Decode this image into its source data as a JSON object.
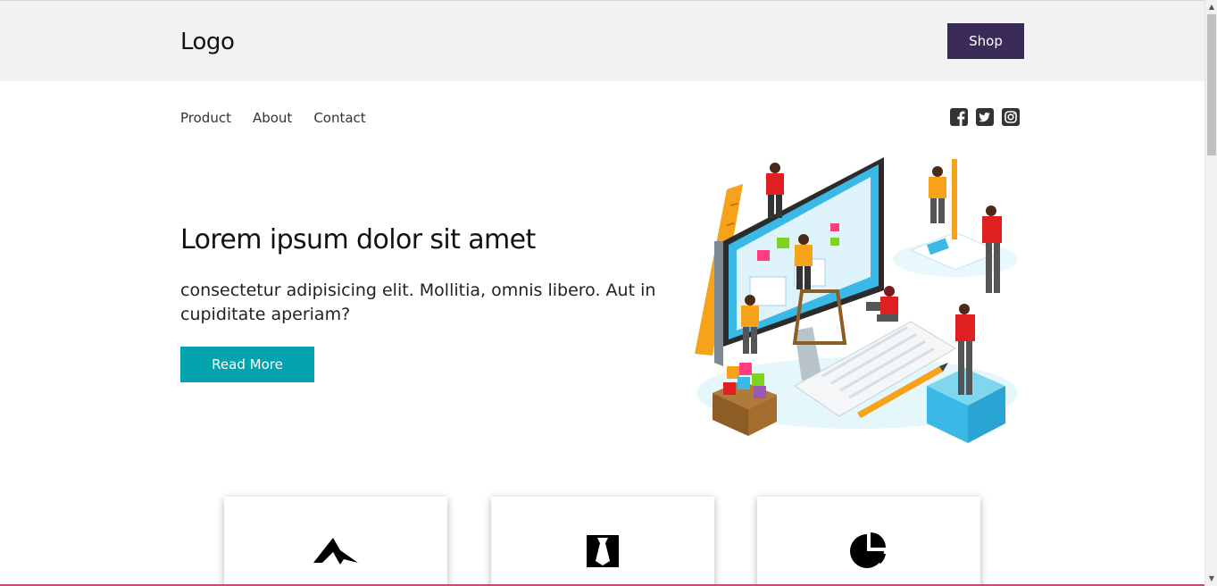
{
  "header": {
    "logo": "Logo",
    "shop_label": "Shop"
  },
  "nav": {
    "items": [
      "Product",
      "About",
      "Contact"
    ]
  },
  "social": {
    "icons": [
      "facebook-icon",
      "twitter-icon",
      "instagram-icon"
    ]
  },
  "hero": {
    "title": "Lorem ipsum dolor sit amet",
    "text": "consectetur adipisicing elit. Mollitia, omnis libero. Aut in cupiditate aperiam?",
    "button_label": "Read More",
    "illustration": "isometric-team-building-website-illustration"
  },
  "features": {
    "cards": [
      {
        "icon": "paper-plane-icon"
      },
      {
        "icon": "necktie-icon"
      },
      {
        "icon": "pie-chart-icon"
      }
    ]
  },
  "colors": {
    "header_bg": "#f2f2f2",
    "shop_button": "#3b2b58",
    "read_more_button": "#05a3ae",
    "accent_line": "#c94d69"
  }
}
